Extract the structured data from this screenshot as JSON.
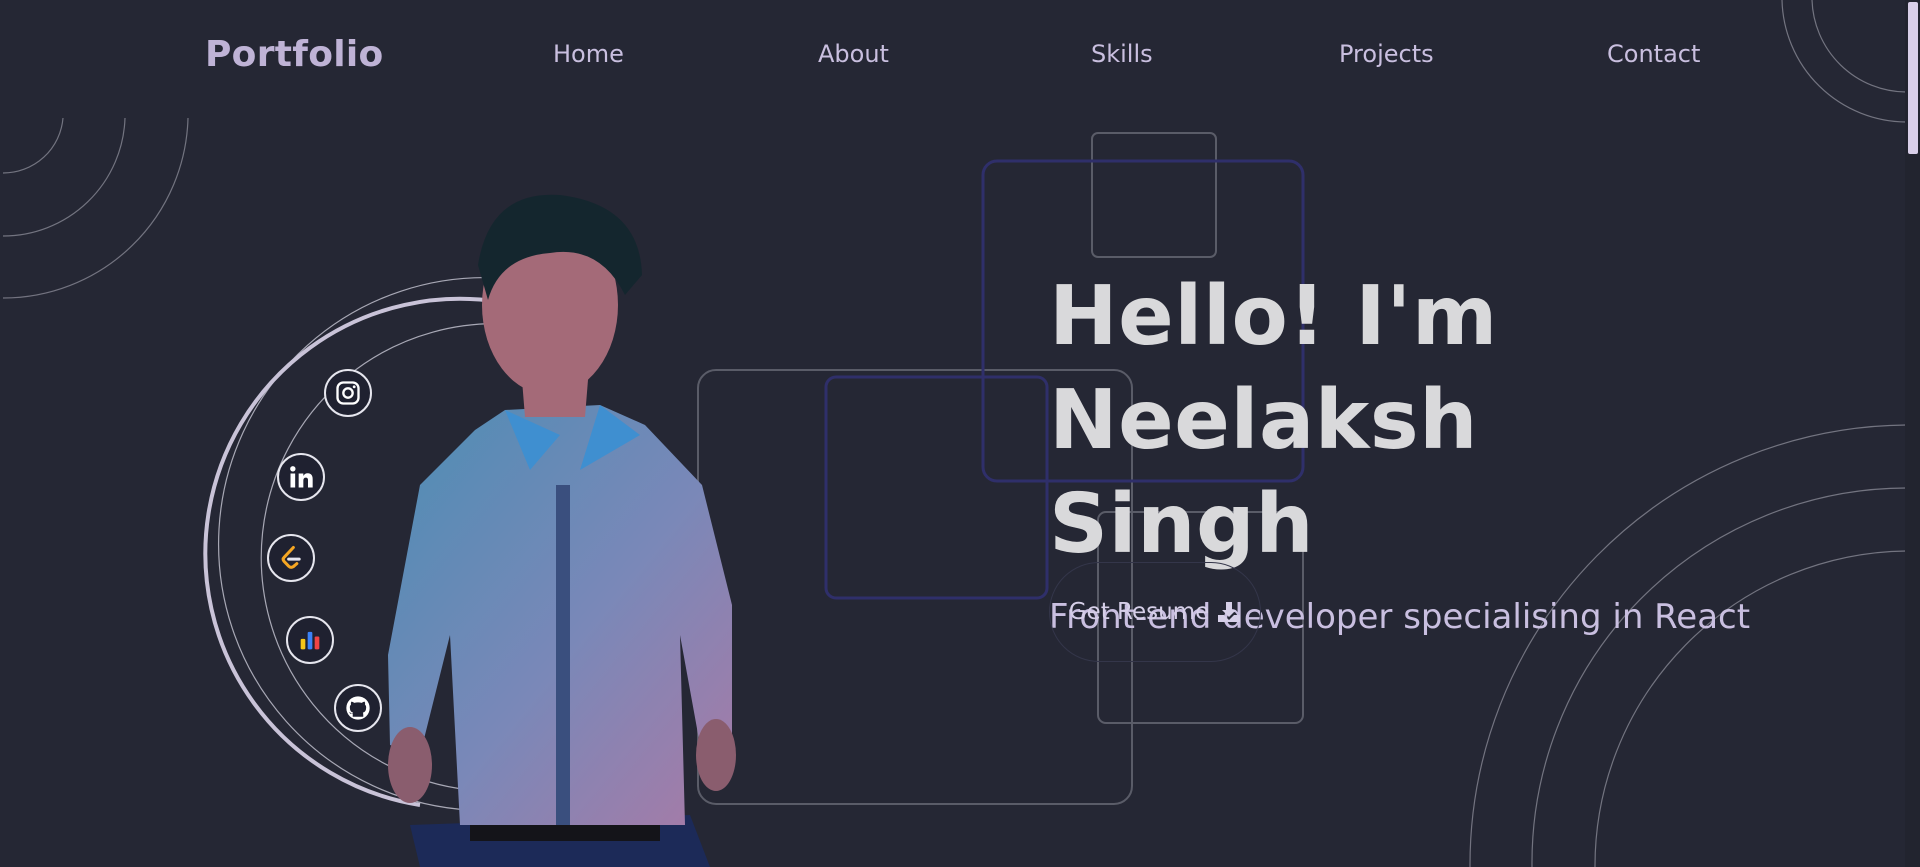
{
  "navbar": {
    "brand": "Portfolio",
    "links": [
      {
        "label": "Home"
      },
      {
        "label": "About"
      },
      {
        "label": "Skills"
      },
      {
        "label": "Projects"
      },
      {
        "label": "Contact"
      }
    ]
  },
  "hero": {
    "title_line1": "Hello! I'm",
    "title_line2": "Neelaksh Singh",
    "subtitle": "Front-end developer specialising in React",
    "resume_button": "Get Resume"
  },
  "social_links": [
    {
      "name": "instagram-icon"
    },
    {
      "name": "linkedin-icon"
    },
    {
      "name": "leetcode-icon"
    },
    {
      "name": "codechef-icon"
    },
    {
      "name": "github-icon"
    }
  ],
  "colors": {
    "background": "#252734",
    "accent": "#bfb3d6",
    "text": "#d9d9db",
    "indigo_outline": "#2f2f6a"
  }
}
